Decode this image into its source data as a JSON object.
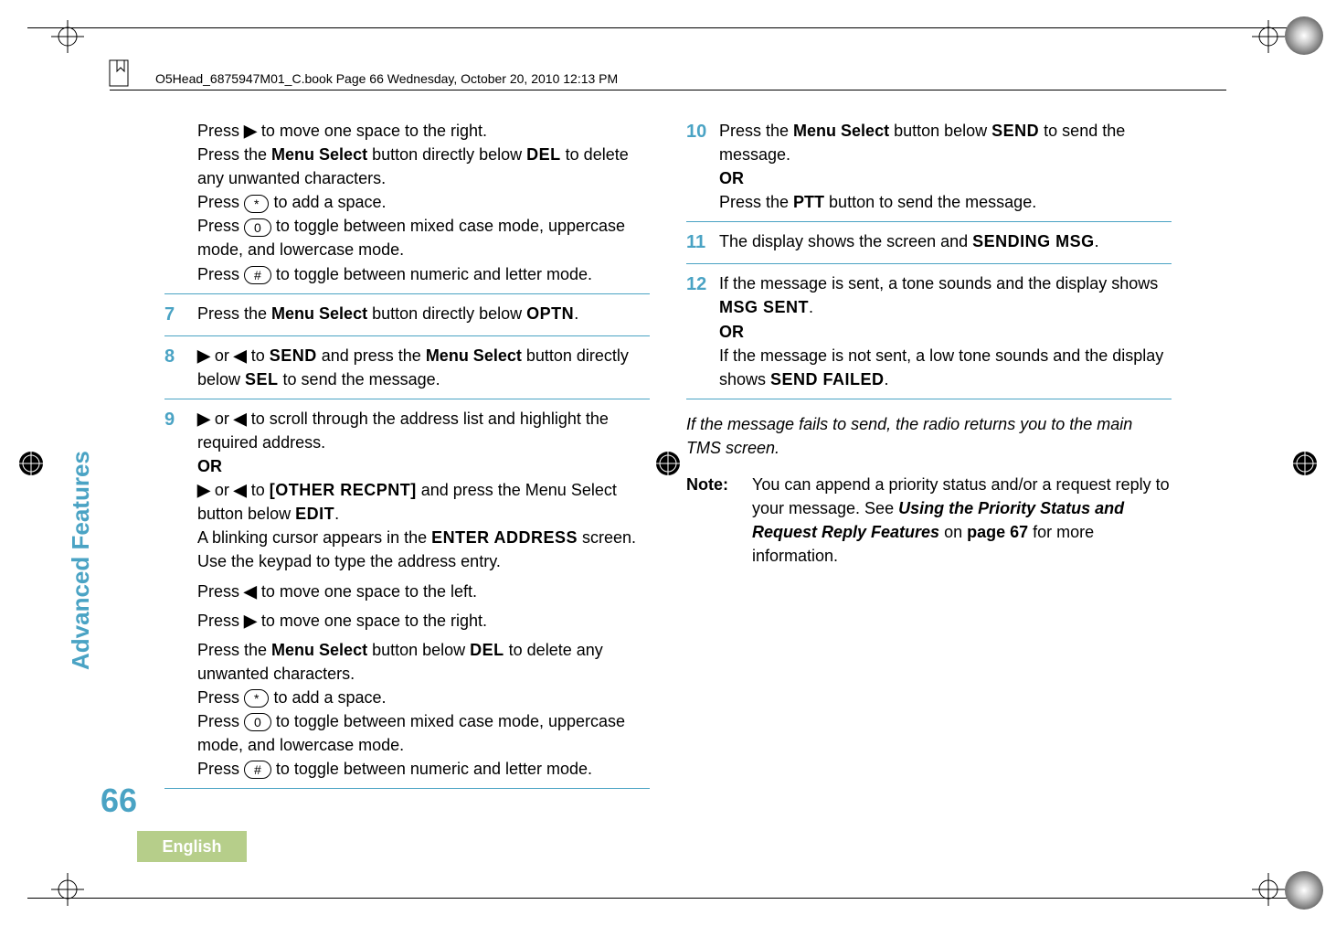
{
  "header": {
    "filename_line": "O5Head_6875947M01_C.book  Page 66  Wednesday, October 20, 2010  12:13 PM"
  },
  "side": {
    "section": "Advanced Features",
    "page_number": "66",
    "language": "English"
  },
  "icons": {
    "arrow_right": "▶",
    "arrow_left": "◀",
    "key_star": "*",
    "key_zero": "0",
    "key_hash": "#"
  },
  "left_col": {
    "intro": {
      "l1a": "Press ",
      "l1b": " to move one space to the right.",
      "l2a": "Press the ",
      "l2b": "Menu Select",
      "l2c": " button directly below ",
      "l2d": "DEL",
      "l2e": " to delete any unwanted characters.",
      "l3a": "Press ",
      "l3b": " to add a space.",
      "l4a": "Press ",
      "l4b": " to toggle between mixed case mode, uppercase mode, and lowercase mode.",
      "l5a": "Press ",
      "l5b": " to toggle between numeric and letter mode."
    },
    "step7": {
      "num": "7",
      "a": "Press the ",
      "b": "Menu Select",
      "c": " button directly below ",
      "d": "OPTN",
      "e": "."
    },
    "step8": {
      "num": "8",
      "a1": " or ",
      "a2": " to ",
      "b": "SEND",
      "c": " and press the ",
      "d": "Menu Select",
      "e": " button directly below ",
      "f": "SEL",
      "g": " to send the message."
    },
    "step9": {
      "num": "9",
      "a1": " or ",
      "a2": " to scroll through the address list and highlight the required address.",
      "or": "OR",
      "b1": " or ",
      "b2": " to ",
      "c": "[OTHER RECPNT]",
      "d": " and press the Menu Select button below ",
      "e": "EDIT",
      "f": ".",
      "g1": "A blinking cursor appears in the ",
      "g2": "ENTER ADDRESS",
      "g3": " screen.",
      "h": "Use the keypad to type the address entry.",
      "i1": "Press ",
      "i2": " to move one space to the left.",
      "j1": "Press ",
      "j2": " to move one space to the right.",
      "k1": "Press the ",
      "k2": "Menu Select",
      "k3": " button below ",
      "k4": "DEL",
      "k5": " to delete any unwanted characters.",
      "l1": "Press ",
      "l2": " to add a space.",
      "m1": "Press ",
      "m2": " to toggle between mixed case mode, uppercase mode, and lowercase mode.",
      "n1": "Press ",
      "n2": " to toggle between numeric and letter mode."
    }
  },
  "right_col": {
    "step10": {
      "num": "10",
      "a": "Press the ",
      "b": "Menu Select",
      "c": " button below ",
      "d": "SEND",
      "e": " to send the message.",
      "or": "OR",
      "f": "Press the ",
      "g": "PTT",
      "h": " button to send the message."
    },
    "step11": {
      "num": "11",
      "a": "The display shows the screen and ",
      "b": "SENDING MSG",
      "c": "."
    },
    "step12": {
      "num": "12",
      "a": "If the message is sent, a tone sounds and the display shows ",
      "b": "MSG SENT",
      "c": ".",
      "or": "OR",
      "d": "If the message is not sent, a low tone sounds and the display shows ",
      "e": "SEND FAILED",
      "f": "."
    },
    "tail_italic": "If the message fails to send, the radio returns you to the main TMS screen.",
    "note": {
      "label": "Note:",
      "a": "You can append a priority status and/or a request reply to your message. See ",
      "b": "Using the Priority Status and Request Reply Features",
      "c": " on ",
      "d": "page 67",
      "e": " for more information."
    }
  }
}
